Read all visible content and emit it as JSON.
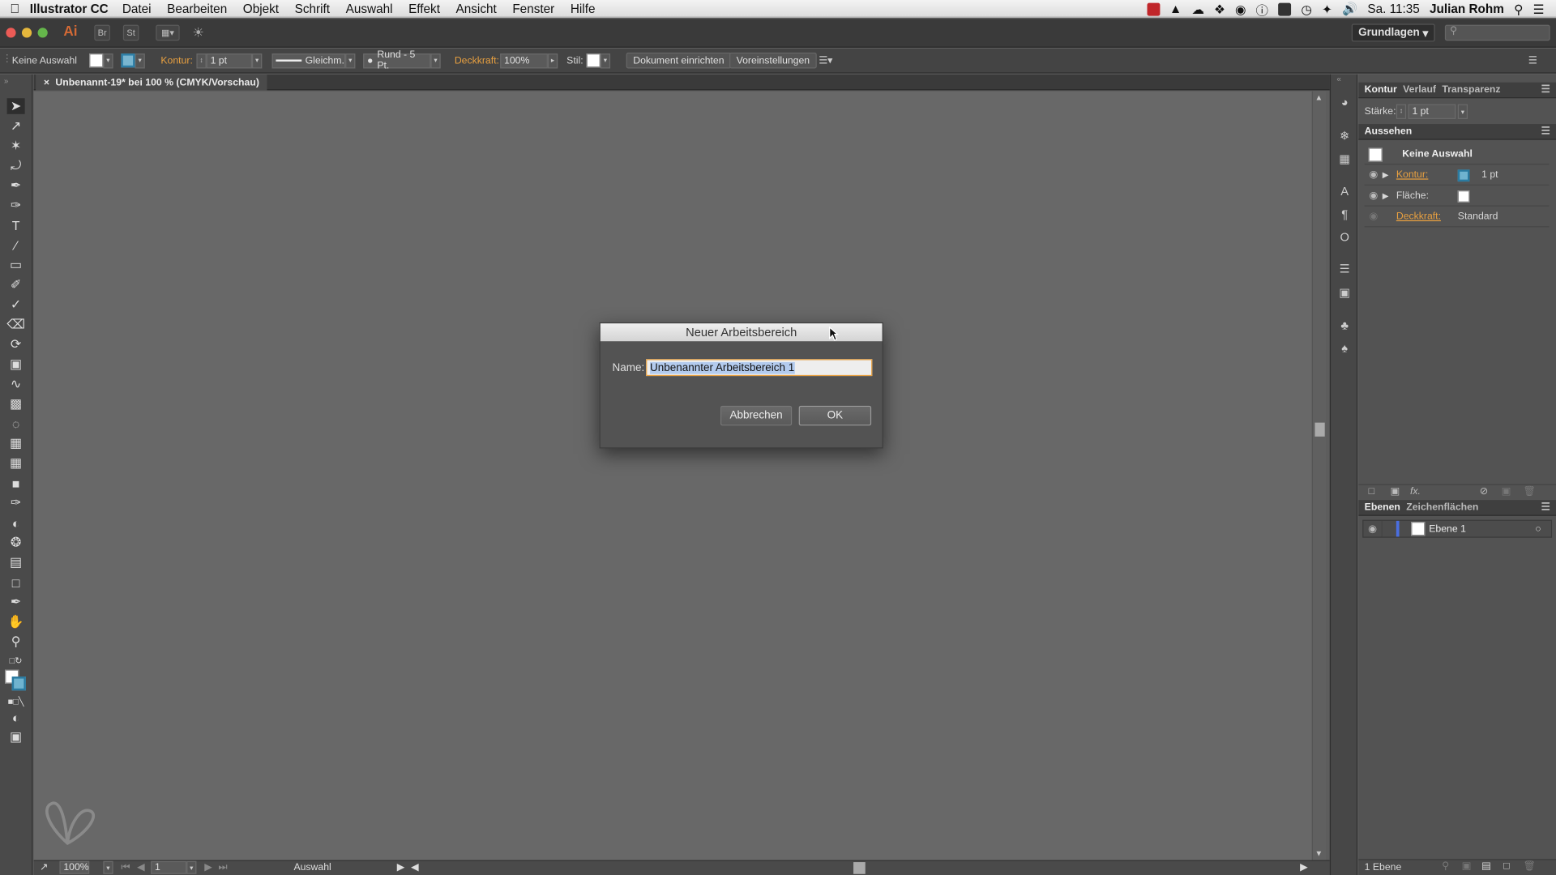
{
  "menubar": {
    "app_name": "Illustrator CC",
    "items": [
      "Datei",
      "Bearbeiten",
      "Objekt",
      "Schrift",
      "Auswahl",
      "Effekt",
      "Ansicht",
      "Fenster",
      "Hilfe"
    ],
    "clock": "Sa. 11:35",
    "user": "Julian Rohm"
  },
  "appbar": {
    "ai_label": "Ai",
    "br_label": "Br",
    "st_label": "St",
    "workspace": "Grundlagen"
  },
  "control": {
    "selection": "Keine Auswahl",
    "stroke_label": "Kontur:",
    "stroke_value": "1 pt",
    "stroke_style": "Gleichm.",
    "brush": "Rund - 5 Pt.",
    "opacity_label": "Deckkraft:",
    "opacity_value": "100%",
    "style_label": "Stil:",
    "doc_setup": "Dokument einrichten",
    "preferences": "Voreinstellungen"
  },
  "document": {
    "tab_title": "Unbenannt-19* bei 100 % (CMYK/Vorschau)"
  },
  "statusbar": {
    "zoom": "100%",
    "page": "1",
    "tool": "Auswahl"
  },
  "kontur_panel": {
    "tabs": [
      "Kontur",
      "Verlauf",
      "Transparenz"
    ],
    "weight_label": "Stärke:",
    "weight_value": "1 pt"
  },
  "appearance_panel": {
    "title": "Aussehen",
    "selection": "Keine Auswahl",
    "stroke_label": "Kontur:",
    "stroke_value": "1 pt",
    "fill_label": "Fläche:",
    "opacity_label": "Deckkraft:",
    "opacity_value": "Standard",
    "fx_label": "fx."
  },
  "layers_panel": {
    "tabs": [
      "Ebenen",
      "Zeichenflächen"
    ],
    "layer_name": "Ebene 1",
    "count": "1 Ebene"
  },
  "dialog": {
    "title": "Neuer Arbeitsbereich",
    "name_label": "Name:",
    "name_value": "Unbenannter Arbeitsbereich 1",
    "cancel": "Abbrechen",
    "ok": "OK"
  },
  "colors": {
    "accent": "#e8a040",
    "canvas": "#686868",
    "panel": "#535353"
  }
}
